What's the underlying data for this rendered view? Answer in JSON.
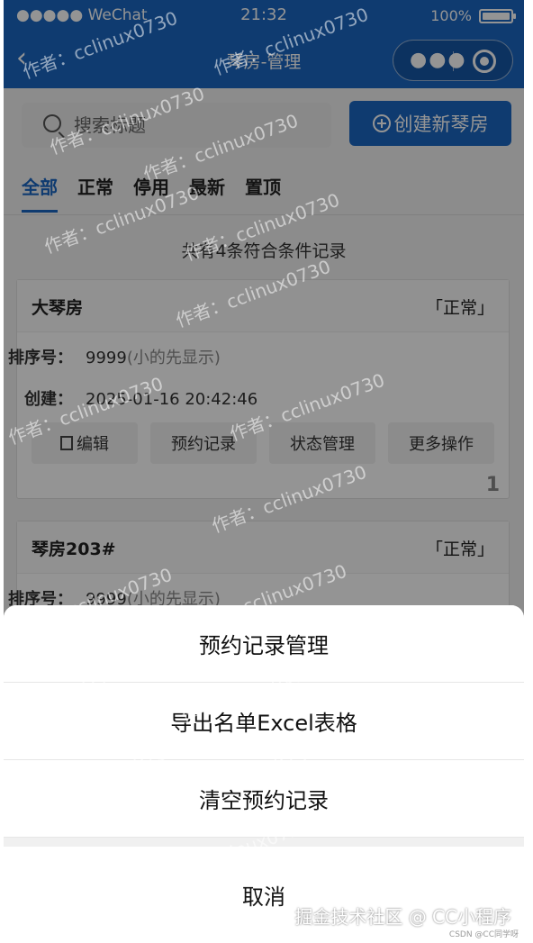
{
  "status_bar": {
    "carrier": "●●●●● WeChat",
    "time": "21:32",
    "battery": "100%",
    "battery_level": 1.0
  },
  "nav": {
    "back_icon": "back-chevron-icon",
    "title": "琴房-管理",
    "capsule_more_icon": "more-dots-icon",
    "capsule_close_icon": "target-icon"
  },
  "search": {
    "placeholder": "搜索标题"
  },
  "create_button": "创建新琴房",
  "tabs": [
    "全部",
    "正常",
    "停用",
    "最新",
    "置顶"
  ],
  "active_tab": "全部",
  "record_count": "共有4条符合条件记录",
  "cards": [
    {
      "name": "大琴房",
      "status": "「正常」",
      "sort_label": "排序号",
      "sort_value": "9999",
      "sort_hint": "(小的先显示)",
      "created_label": "创建",
      "created_value": "2025-01-16 20:42:46",
      "actions": [
        "编辑",
        "预约记录",
        "状态管理",
        "更多操作"
      ],
      "index": "1"
    },
    {
      "name": "琴房203#",
      "status": "「正常」",
      "sort_label": "排序号",
      "sort_value": "9999",
      "sort_hint": "(小的先显示)"
    }
  ],
  "sheet": {
    "items": [
      "预约记录管理",
      "导出名单Excel表格",
      "清空预约记录"
    ],
    "cancel": "取消"
  },
  "watermark": "作者：cclinux0730",
  "credit": "掘金技术社区 @ CC小程序",
  "csdn": "CSDN @CC同学呀",
  "colors": {
    "brand_blue": "#1a66c2",
    "mask": "rgba(0,0,0,0.42)"
  }
}
